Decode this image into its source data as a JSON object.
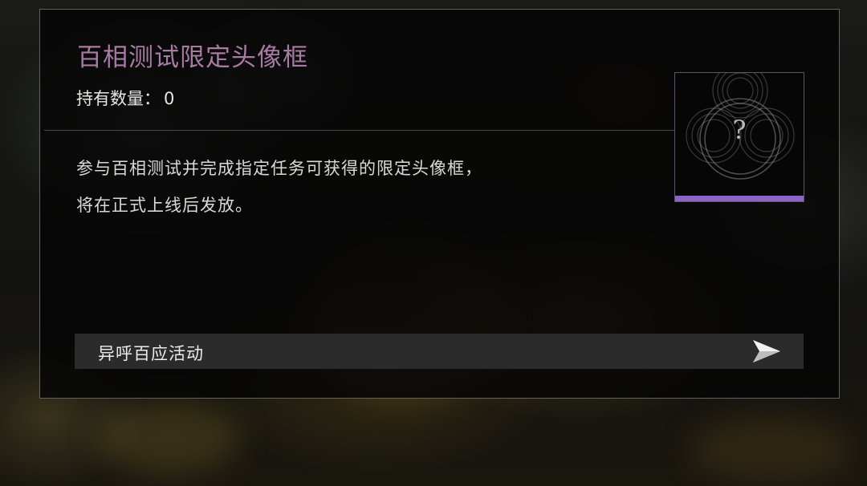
{
  "item": {
    "title": "百相测试限定头像框",
    "owned_label": "持有数量：",
    "owned_count": "0",
    "description_lines": [
      "参与百相测试并完成指定任务可获得的限定头像框，",
      "将在正式上线后发放。"
    ],
    "preview_placeholder": "?"
  },
  "source": {
    "label": "异呼百应活动",
    "icon": "arrow-right-icon"
  },
  "colors": {
    "title": "#a77ba3",
    "rarity_bar": "#8c63c8",
    "panel_border": "#aaaaaa"
  }
}
